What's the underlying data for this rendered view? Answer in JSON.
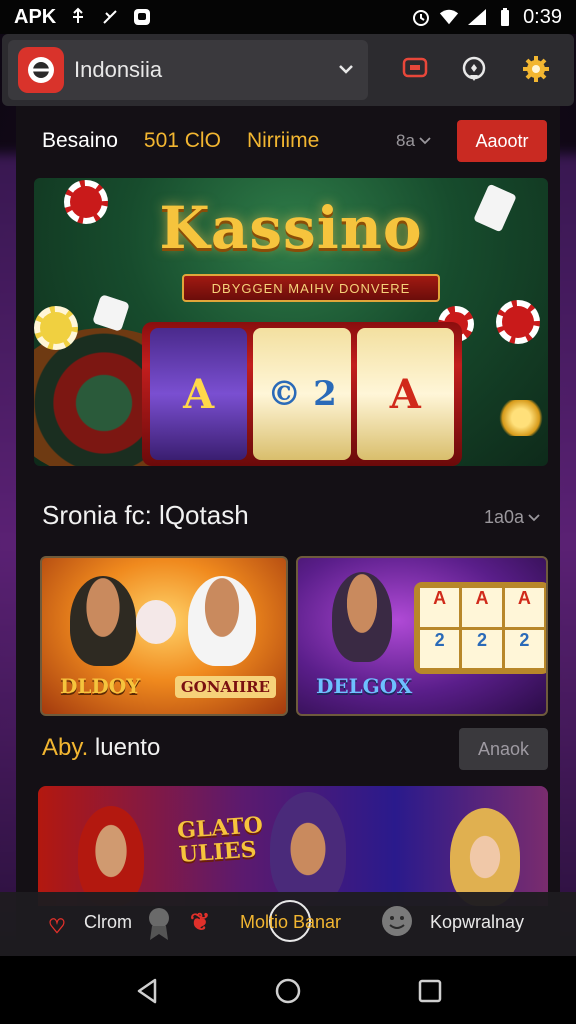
{
  "status_bar": {
    "left_label": "APK",
    "time": "0:39",
    "icons": [
      "usb-icon",
      "call-icon",
      "app-icon",
      "alarm-icon",
      "wifi-icon",
      "signal-icon",
      "battery-icon"
    ]
  },
  "top_bar": {
    "country": "Indonsiia",
    "icons": [
      "message-icon",
      "location-icon",
      "settings-icon"
    ]
  },
  "nav": {
    "items": [
      "Besaino",
      "501 ClO",
      "Nirriime"
    ],
    "lang": "8a",
    "account_button": "Aaootr"
  },
  "hero": {
    "title": "Kassino",
    "ribbon": "DBYGGEN MAIHV DONVERE",
    "reel_symbols": [
      "A",
      "© 2",
      "A"
    ]
  },
  "section1": {
    "title": "Sronia fc: lQotash",
    "count": "1a0a"
  },
  "tiles": [
    {
      "label": "DLDOY",
      "label2": "GONAIIRE"
    },
    {
      "label": "DELGOX",
      "reels": [
        "A",
        "A",
        "A",
        "2",
        "2",
        "2"
      ]
    }
  ],
  "section2": {
    "title_accent": "Aby.",
    "title_rest": " luento",
    "button": "Anaok"
  },
  "promo": {
    "text_line1": "GLATO",
    "text_line2": "ULIES"
  },
  "bottom_bar": {
    "left": "Clrom",
    "center": "Moltio Banar",
    "right": "Kopwralnay"
  },
  "colors": {
    "accent_red": "#c92a22",
    "accent_gold": "#f2b631",
    "panel": "#141015"
  }
}
